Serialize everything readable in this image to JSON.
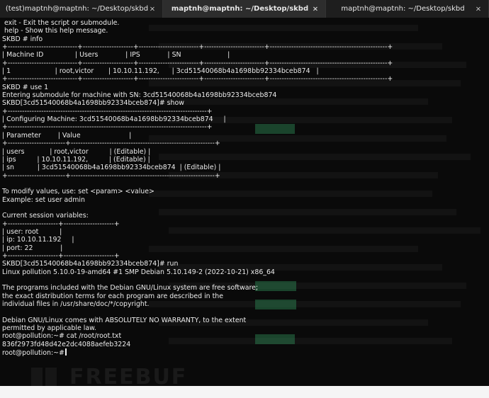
{
  "tabs": [
    {
      "label": "(test)maptnh@maptnh: ~/Desktop/skbd",
      "active": false
    },
    {
      "label": "maptnh@maptnh: ~/Desktop/skbd",
      "active": true
    },
    {
      "label": "maptnh@maptnh: ~/Desktop/skbd",
      "active": false
    }
  ],
  "icons": {
    "tab_close": "×"
  },
  "terminal": {
    "lines": [
      " exit - Exit the script or submodule.",
      " help - Show this help message.",
      "SKBD # info",
      "+-----------------------------+---------------------+-------------------------+-------------------------+-------------------------------------------------+",
      "| Machine ID               | Users             | IPS             | SN                      |",
      "+-----------------------------+---------------------+-------------------------+-------------------------+-------------------------------------------------+",
      "| 1                     | root,victor       | 10.10.11.192,      | 3cd51540068b4a1698bb92334bceb874   |",
      "+-----------------------------+---------------------+-------------------------+-------------------------+-------------------------------------------------+",
      "SKBD # use 1",
      "Entering submodule for machine with SN: 3cd51540068b4a1698bb92334bceb874",
      "SKBD[3cd51540068b4a1698bb92334bceb874]# show",
      "+-----------------------------------------------------------------------------------+",
      "| Configuring Machine: 3cd51540068b4a1698bb92334bceb874     |",
      "+-----------------------------------------------------------------------------------+",
      "| Parameter        | Value                       |",
      "+------------------------+------------------------------------------------------------+",
      "| users            | root,victor          | (Editable) |",
      "| ips          | 10.10.11.192,          | (Editable) |",
      "| sn           | 3cd51540068b4a1698bb92334bceb874  | (Editable) |",
      "+------------------------+------------------------------------------------------------+",
      "",
      "To modify values, use: set <param> <value>",
      "Example: set user admin",
      "",
      "Current session variables:",
      "+---------------------+---------------------+",
      "| user: root          |",
      "| ip: 10.10.11.192     |",
      "| port: 22             |",
      "+---------------------+---------------------+",
      "SKBD[3cd51540068b4a1698bb92334bceb874]# run",
      "Linux pollution 5.10.0-19-amd64 #1 SMP Debian 5.10.149-2 (2022-10-21) x86_64",
      "",
      "The programs included with the Debian GNU/Linux system are free software;",
      "the exact distribution terms for each program are described in the",
      "individual files in /usr/share/doc/*/copyright.",
      "",
      "Debian GNU/Linux comes with ABSOLUTELY NO WARRANTY, to the extent",
      "permitted by applicable law.",
      "root@pollution:~# cat /root/root.txt",
      "836f2973fd48d42e2dc4088aefeb3224",
      "root@pollution:~#"
    ]
  },
  "background_colors": {
    "terminal_bg": "#0a0a0a",
    "tabbar_bg": "#1e1e1e",
    "active_tab_bg": "#2d2d2d",
    "text": "#ececec",
    "highlight_green": "#2e8b57"
  }
}
